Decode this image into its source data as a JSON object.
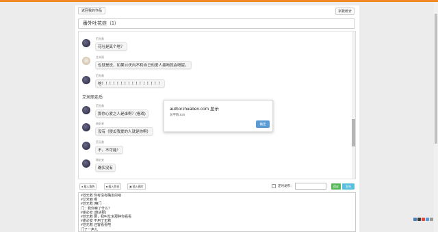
{
  "buttons": {
    "back": "返回我的作品",
    "word_count": "字数统计"
  },
  "title": "番外吐花症（1）",
  "messages": [
    {
      "type": "msg",
      "name": "范无救",
      "text": "花吐是真个啥？",
      "avatar": "dark"
    },
    {
      "type": "msg",
      "name": "艾米丽",
      "text": "也就是说，如果10天内不和自己的爱人接吻就会嗝屁。",
      "avatar": "light"
    },
    {
      "type": "msg",
      "name": "范无救",
      "text": "啥！！！！！！！！！！！！！！！！",
      "avatar": "dark"
    },
    {
      "type": "narration",
      "text": "艾米丽走后"
    },
    {
      "type": "msg",
      "name": "范无救",
      "text": "那你心爱之人是谁啊？(看戏)",
      "avatar": "dark"
    },
    {
      "type": "msg",
      "name": "谢必安",
      "text": "没有（傻瓜我爱的人就是你啊）",
      "avatar": "dark2"
    },
    {
      "type": "msg",
      "name": "范无救",
      "text": "不，不可能！",
      "avatar": "dark"
    },
    {
      "type": "msg",
      "name": "谢必安",
      "text": "确实没有",
      "avatar": "dark2"
    }
  ],
  "dialog": {
    "title": "author.ihuaben.com 显示",
    "body": "总字数:520",
    "ok_label": "确定"
  },
  "toolbar": {
    "insert_role": "插入角色",
    "insert_narration": "插入旁白",
    "insert_image": "插入图片",
    "timed_publish": "定时发布：",
    "save": "保存",
    "publish": "发布"
  },
  "editor_lines": [
    "#范无救 你考没有确定的吧",
    "#艾米丽 嗯",
    "#范无救 [嘛门",
    "门：我你嘛了什么？",
    "#谢必安 [谁进那]",
    "#范无救 要，我叫艾米那种你看看",
    "#谢必安 不用了无救",
    "#范无救 还客看看吧",
    "门了一声儿"
  ],
  "colors": {
    "accent": "#f08a24",
    "save": "#5cb85c",
    "publish": "#5bc0de",
    "dialog_ok": "#5b9bd5"
  }
}
